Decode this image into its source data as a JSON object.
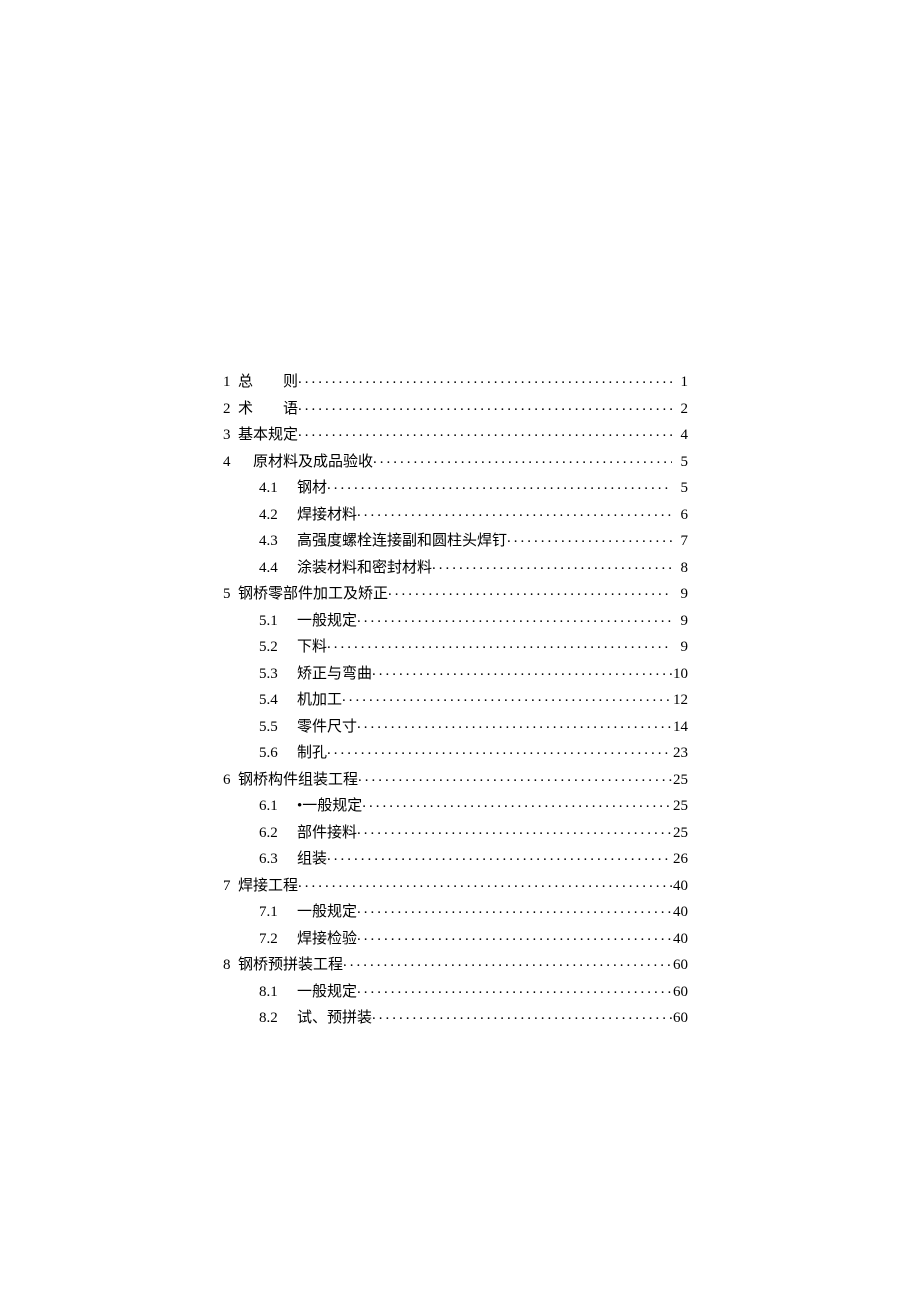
{
  "toc": [
    {
      "level": 1,
      "num": "1",
      "title": "总　　则",
      "page": "1",
      "spaced": false
    },
    {
      "level": 1,
      "num": "2",
      "title": "术　　语",
      "page": "2",
      "spaced": false
    },
    {
      "level": 1,
      "num": "3",
      "title": "基本规定",
      "page": "4",
      "spaced": false
    },
    {
      "level": 1,
      "num": "4",
      "title": "　原材料及成品验收",
      "page": "5",
      "spaced": false
    },
    {
      "level": 2,
      "num": "4.1",
      "title": "钢材",
      "page": "5"
    },
    {
      "level": 2,
      "num": "4.2",
      "title": "焊接材料",
      "page": "6"
    },
    {
      "level": 2,
      "num": "4.3",
      "title": "高强度螺栓连接副和圆柱头焊钉",
      "page": "7"
    },
    {
      "level": 2,
      "num": "4.4",
      "title": "涂装材料和密封材料",
      "page": "8"
    },
    {
      "level": 1,
      "num": "5",
      "title": "钢桥零部件加工及矫正",
      "page": "9",
      "spaced": false
    },
    {
      "level": 2,
      "num": "5.1",
      "title": "一般规定",
      "page": "9"
    },
    {
      "level": 2,
      "num": "5.2",
      "title": "下料",
      "page": "9"
    },
    {
      "level": 2,
      "num": "5.3",
      "title": "矫正与弯曲",
      "page": "10"
    },
    {
      "level": 2,
      "num": "5.4",
      "title": "机加工",
      "page": "12"
    },
    {
      "level": 2,
      "num": "5.5",
      "title": "零件尺寸",
      "page": "14"
    },
    {
      "level": 2,
      "num": "5.6",
      "title": "制孔",
      "page": "23"
    },
    {
      "level": 1,
      "num": "6",
      "title": "钢桥构件组装工程",
      "page": "25",
      "spaced": false
    },
    {
      "level": 2,
      "num": "6.1",
      "title": "•一般规定",
      "page": "25"
    },
    {
      "level": 2,
      "num": "6.2",
      "title": "部件接料",
      "page": "25"
    },
    {
      "level": 2,
      "num": "6.3",
      "title": "组装",
      "page": "26"
    },
    {
      "level": 1,
      "num": "7",
      "title": "焊接工程",
      "page": "40",
      "spaced": false
    },
    {
      "level": 2,
      "num": "7.1",
      "title": "一般规定",
      "page": "40"
    },
    {
      "level": 2,
      "num": "7.2",
      "title": "焊接检验",
      "page": "40"
    },
    {
      "level": 1,
      "num": "8",
      "title": "钢桥预拼装工程",
      "page": "60",
      "spaced": false
    },
    {
      "level": 2,
      "num": "8.1",
      "title": "一般规定",
      "page": "60"
    },
    {
      "level": 2,
      "num": "8.2",
      "title": "试、预拼装",
      "page": "60"
    }
  ]
}
